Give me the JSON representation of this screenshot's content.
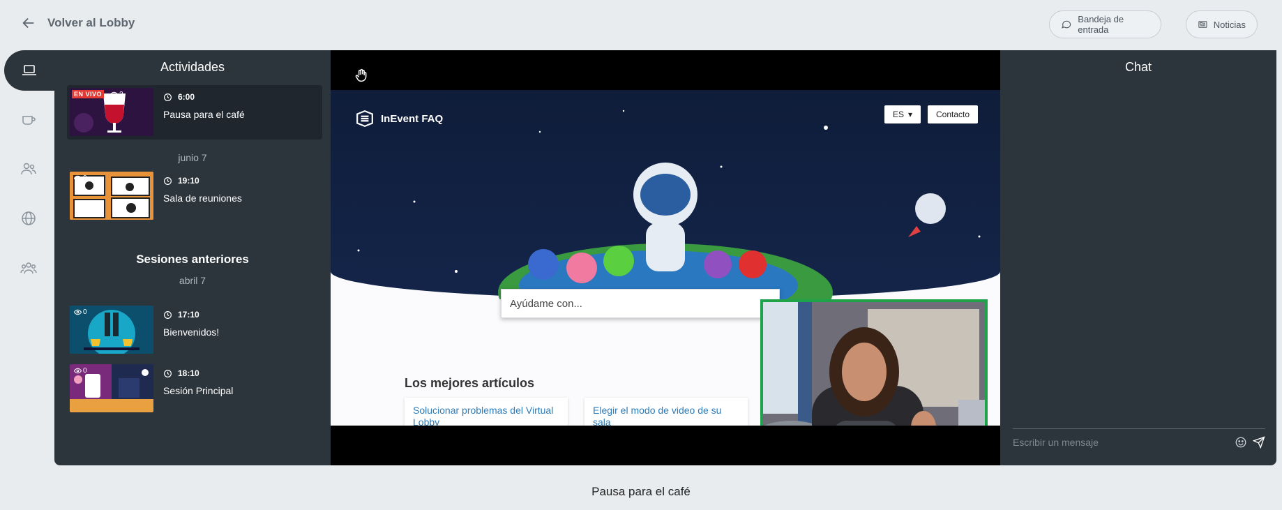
{
  "header": {
    "back_label": "Volver al Lobby",
    "inbox_label": "Bandeja de entrada",
    "news_label": "Noticias"
  },
  "rail": {
    "items": [
      "laptop-icon",
      "coffee-icon",
      "users-icon",
      "globe-icon",
      "group-icon"
    ]
  },
  "activities": {
    "title": "Actividades",
    "current": {
      "live_badge": "EN VIVO",
      "viewers": "2",
      "time": "6:00",
      "name": "Pausa para el café"
    },
    "upcoming_date": "junio 7",
    "upcoming": [
      {
        "viewers": "0",
        "time": "19:10",
        "name": "Sala de reuniones"
      }
    ],
    "past_title": "Sesiones anteriores",
    "past_date": "abril 7",
    "past": [
      {
        "viewers": "0",
        "time": "17:10",
        "name": "Bienvenidos!"
      },
      {
        "viewers": "0",
        "time": "18:10",
        "name": "Sesión Principal"
      }
    ]
  },
  "video": {
    "site_title": "InEvent FAQ",
    "lang": "ES",
    "contact": "Contacto",
    "search_placeholder": "Ayúdame con...",
    "best_title": "Los mejores artículos",
    "cards": [
      "Solucionar problemas del Virtual Lobby",
      "Elegir el modo de video de su sala"
    ]
  },
  "chat": {
    "title": "Chat",
    "input_placeholder": "Escribir un mensaje"
  },
  "footer": {
    "title": "Pausa para el café"
  },
  "colors": {
    "panel": "#2c343c",
    "active_item": "#1f262d",
    "live": "#e53935",
    "webcam_border": "#1fa34a",
    "link": "#2b7bb9"
  }
}
